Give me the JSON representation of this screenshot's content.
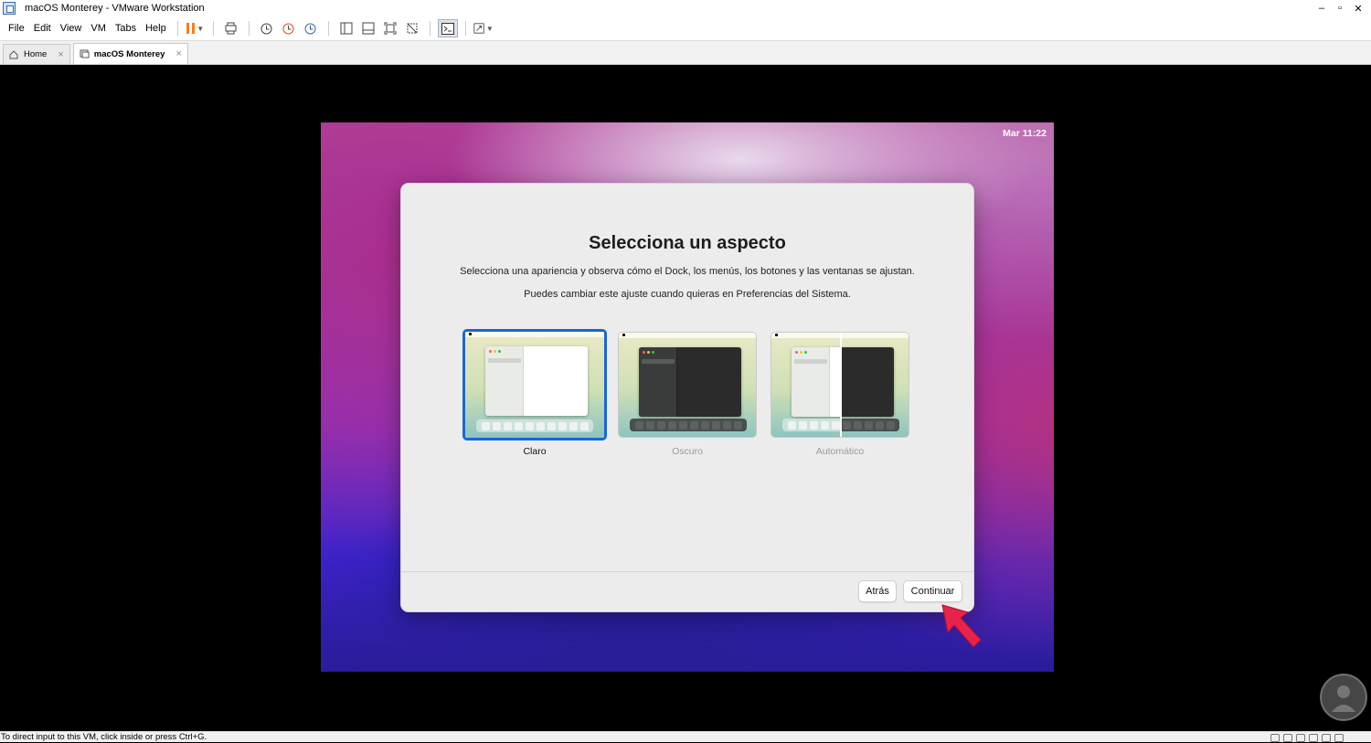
{
  "window": {
    "title": "macOS Monterey - VMware Workstation",
    "minimize": "–",
    "maximize": "▫",
    "close": "✕"
  },
  "menu": {
    "file": "File",
    "edit": "Edit",
    "view": "View",
    "vm": "VM",
    "tabs": "Tabs",
    "help": "Help"
  },
  "toolbar_icons": [
    "pause-icon",
    "send-ctrl-alt-del-icon",
    "snapshot-icon",
    "revert-snapshot-icon",
    "snapshot-manager-icon",
    "library-icon",
    "thumbnail-icon",
    "full-screen-icon",
    "unity-icon",
    "console-view-icon",
    "stretch-icon"
  ],
  "tabs": [
    {
      "label": "Home",
      "close": "×"
    },
    {
      "label": "macOS Monterey",
      "close": "×"
    }
  ],
  "guest": {
    "clock": "Mar 11:22",
    "dialog": {
      "title": "Selecciona un aspecto",
      "description": "Selecciona una apariencia y observa cómo el Dock, los menús, los botones y las ventanas se ajustan.",
      "note": "Puedes cambiar este ajuste cuando quieras en Preferencias del Sistema.",
      "options": [
        {
          "label": "Claro",
          "selected": true
        },
        {
          "label": "Oscuro",
          "selected": false
        },
        {
          "label": "Automático",
          "selected": false
        }
      ],
      "back_button": "Atrás",
      "continue_button": "Continuar"
    }
  },
  "statusbar": {
    "message": "To direct input to this VM, click inside or press Ctrl+G."
  },
  "colors": {
    "selection_blue": "#1a66d6",
    "pause_orange": "#ff7a1a",
    "arrow_red": "#e8224a"
  }
}
